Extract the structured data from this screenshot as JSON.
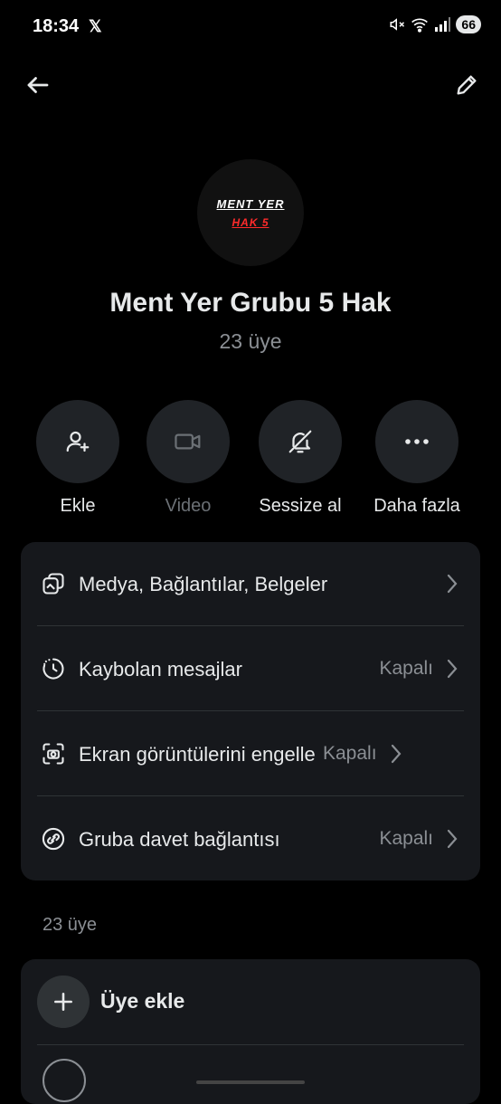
{
  "status_bar": {
    "time": "18:34",
    "app_glyph": "𝕏",
    "battery": "66",
    "icons": [
      "mute-icon",
      "wifi-icon",
      "signal-icon"
    ]
  },
  "header": {
    "back_icon": "arrow-left-icon",
    "edit_icon": "pencil-icon"
  },
  "group": {
    "avatar_line1": "MENT YER",
    "avatar_line2": "HAK 5",
    "title": "Ment Yer Grubu 5 Hak",
    "member_count": "23 üye"
  },
  "actions": [
    {
      "label": "Ekle",
      "icon": "add-user-icon",
      "enabled": true
    },
    {
      "label": "Video",
      "icon": "video-icon",
      "enabled": false
    },
    {
      "label": "Sessize al",
      "icon": "bell-off-icon",
      "enabled": true
    },
    {
      "label": "Daha fazla",
      "icon": "more-icon",
      "enabled": true
    }
  ],
  "settings": [
    {
      "label": "Medya, Bağlantılar, Belgeler",
      "value": "",
      "icon": "media-icon"
    },
    {
      "label": "Kaybolan mesajlar",
      "value": "Kapalı",
      "icon": "timer-icon"
    },
    {
      "label": "Ekran görüntülerini engelle",
      "value": "Kapalı",
      "icon": "screenshot-icon"
    },
    {
      "label": "Gruba davet bağlantısı",
      "value": "Kapalı",
      "icon": "link-icon"
    }
  ],
  "members_section": {
    "label": "23 üye",
    "add_member_label": "Üye ekle"
  },
  "colors": {
    "background": "#000000",
    "card": "#16181c",
    "button": "#202327",
    "muted_text": "#8b8f94",
    "accent_red": "#ff2b2b"
  }
}
